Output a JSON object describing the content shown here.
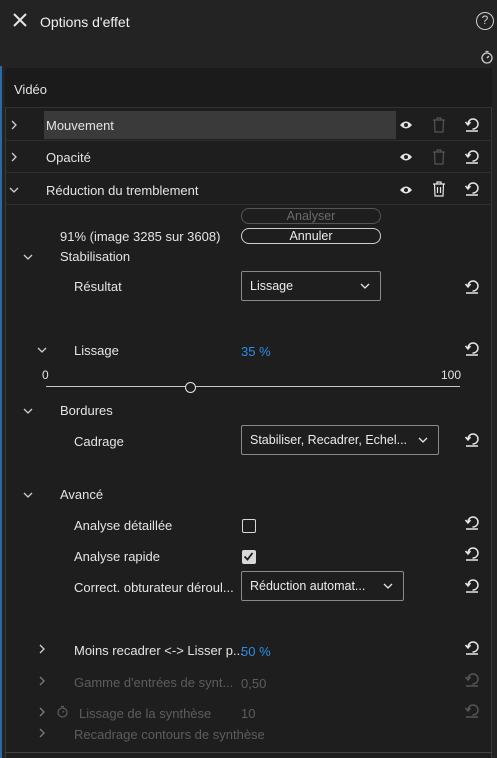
{
  "header": {
    "title": "Options d'effet",
    "help_label": "?"
  },
  "video_label": "Vidéo",
  "effects": [
    {
      "label": "Mouvement"
    },
    {
      "label": "Opacité"
    },
    {
      "label": "Réduction du tremblement"
    }
  ],
  "analyze": {
    "analyser_label": "Analyser",
    "progress_text": "91% (image 3285 sur 3608)",
    "annuler_label": "Annuler"
  },
  "stabilisation": {
    "label": "Stabilisation",
    "resultat_label": "Résultat",
    "resultat_value": "Lissage",
    "lissage_label": "Lissage",
    "lissage_value": "35 %",
    "slider_min": "0",
    "slider_max": "100",
    "slider_level": 0.35
  },
  "bordures": {
    "label": "Bordures",
    "cadrage_label": "Cadrage",
    "cadrage_value": "Stabiliser, Recadrer, Echel..."
  },
  "avance": {
    "label": "Avancé",
    "analyse_detaillee_label": "Analyse détaillée",
    "analyse_detaillee_checked": false,
    "analyse_rapide_label": "Analyse rapide",
    "analyse_rapide_checked": true,
    "obturateur_label": "Correct. obturateur déroul...",
    "obturateur_value": "Réduction automat..."
  },
  "extra": {
    "moins_recadrer_label": "Moins recadrer <-> Lisser p...",
    "moins_recadrer_value": "50 %",
    "gamme_label": "Gamme d'entrées de synt...",
    "gamme_value": "0,50",
    "lissage_synthese_label": "Lissage de la synthèse",
    "lissage_synthese_value": "10",
    "recadrage_label": "Recadrage contours de synthèse"
  },
  "colors": {
    "accent": "#2d8ceb",
    "background": "#1e1e1e",
    "highlight": "#3a3a3a"
  }
}
